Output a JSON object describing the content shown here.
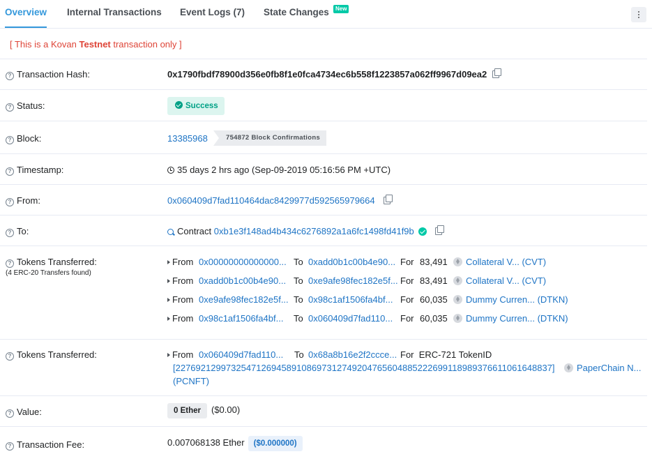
{
  "tabs": [
    {
      "label": "Overview",
      "active": true
    },
    {
      "label": "Internal Transactions",
      "active": false
    },
    {
      "label": "Event Logs (7)",
      "active": false
    },
    {
      "label": "State Changes",
      "active": false,
      "badge": "New"
    }
  ],
  "notice": {
    "prefix": "[ This is a Kovan ",
    "bold": "Testnet",
    "suffix": " transaction only ]"
  },
  "fields": {
    "tx_hash": {
      "label": "Transaction Hash:",
      "value": "0x1790fbdf78900d356e0fb8f1e0fca4734ec6b558f1223857a062ff9967d09ea2"
    },
    "status": {
      "label": "Status:",
      "value": "Success"
    },
    "block": {
      "label": "Block:",
      "value": "13385968",
      "confirmations": "754872 Block Confirmations"
    },
    "timestamp": {
      "label": "Timestamp:",
      "value": "35 days 2 hrs ago (Sep-09-2019 05:16:56 PM +UTC)"
    },
    "from": {
      "label": "From:",
      "value": "0x060409d7fad110464dac8429977d592565979664"
    },
    "to": {
      "label": "To:",
      "prefix": "Contract",
      "value": "0xb1e3f148ad4b434c6276892a1a6fc1498fd41f9b"
    },
    "tokens_erc20": {
      "label": "Tokens Transferred:",
      "sublabel": "(4 ERC-20 Transfers found)"
    },
    "tokens_erc721": {
      "label": "Tokens Transferred:"
    },
    "value": {
      "label": "Value:",
      "amount": "0 Ether",
      "usd": "($0.00)"
    },
    "fee": {
      "label": "Transaction Fee:",
      "amount": "0.007068138 Ether",
      "usd": "($0.000000)"
    }
  },
  "transfers": [
    {
      "from_word": "From",
      "from": "0x00000000000000...",
      "to_word": "To",
      "to": "0xadd0b1c00b4e90...",
      "for_word": "For",
      "amount": "83,491",
      "token": "Collateral V... (CVT)"
    },
    {
      "from_word": "From",
      "from": "0xadd0b1c00b4e90...",
      "to_word": "To",
      "to": "0xe9afe98fec182e5f...",
      "for_word": "For",
      "amount": "83,491",
      "token": "Collateral V... (CVT)"
    },
    {
      "from_word": "From",
      "from": "0xe9afe98fec182e5f...",
      "to_word": "To",
      "to": "0x98c1af1506fa4bf...",
      "for_word": "For",
      "amount": "60,035",
      "token": "Dummy Curren... (DTKN)"
    },
    {
      "from_word": "From",
      "from": "0x98c1af1506fa4bf...",
      "to_word": "To",
      "to": "0x060409d7fad110...",
      "for_word": "For",
      "amount": "60,035",
      "token": "Dummy Curren... (DTKN)"
    }
  ],
  "nft_transfer": {
    "from_word": "From",
    "from": "0x060409d7fad110...",
    "to_word": "To",
    "to": "0x68a8b16e2f2ccce...",
    "for_text": "For  ERC-721 TokenID",
    "token_id": "[227692129973254712694589108697312749204765604885222699118989376611061648837]",
    "token_name": "PaperChain N...",
    "token_symbol": "(PCNFT)"
  },
  "colors": {
    "link": "#1e74c5",
    "active_tab": "#3498db",
    "success": "#00a186",
    "notice": "#de4437"
  },
  "icons": [
    "question-icon",
    "copy-icon",
    "success-check-icon",
    "clock-icon",
    "contract-search-icon",
    "verified-check-icon",
    "caret-right-icon",
    "ether-token-icon",
    "more-vertical-icon"
  ]
}
